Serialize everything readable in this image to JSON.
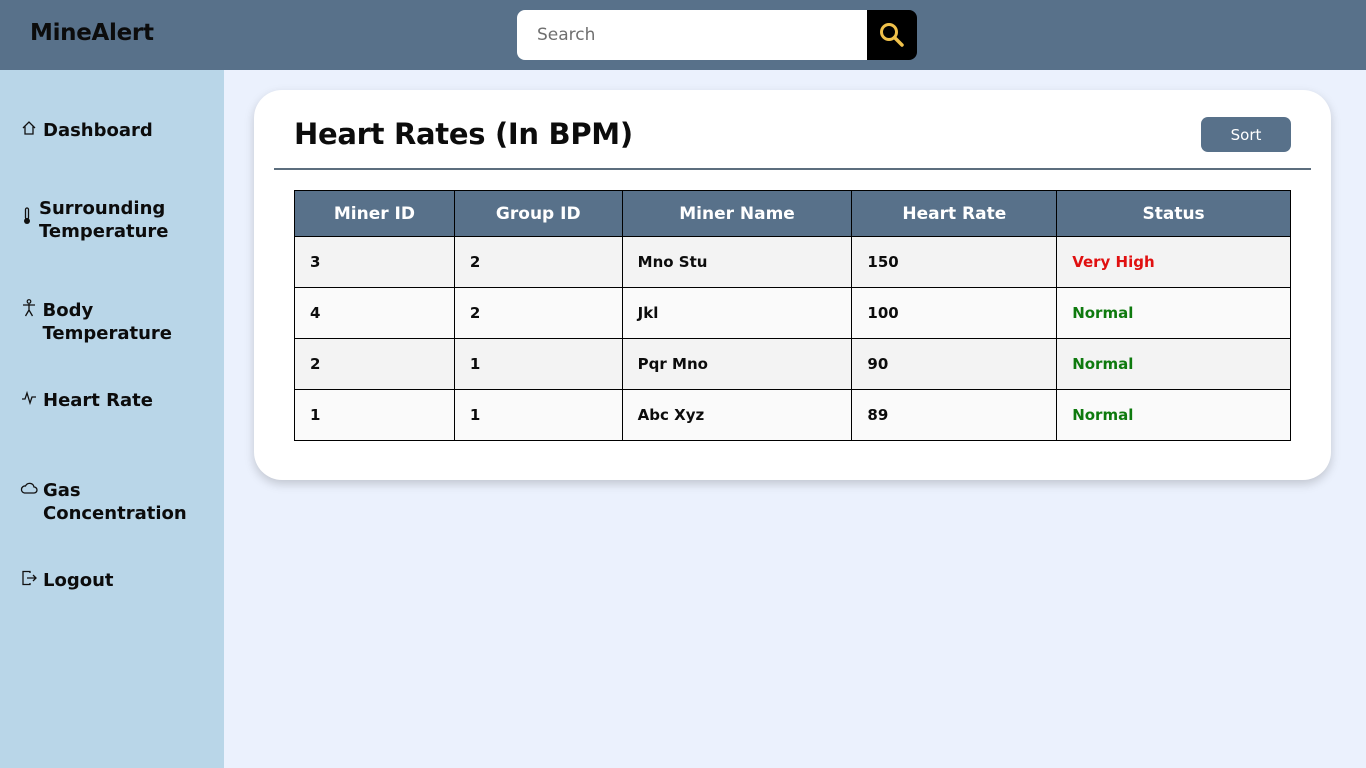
{
  "app": {
    "title": "MineAlert"
  },
  "search": {
    "placeholder": "Search",
    "icon": "search-icon",
    "icon_color": "#f0c14b"
  },
  "sidebar": {
    "items": [
      {
        "label": "Dashboard",
        "icon": "home-icon"
      },
      {
        "label": "Surrounding Temperature",
        "icon": "thermometer-icon"
      },
      {
        "label": "Body Temperature",
        "icon": "body-icon"
      },
      {
        "label": "Heart Rate",
        "icon": "pulse-icon"
      },
      {
        "label": "Gas Concentration",
        "icon": "cloud-icon"
      },
      {
        "label": "Logout",
        "icon": "logout-icon"
      }
    ]
  },
  "main": {
    "title": "Heart Rates (In BPM)",
    "sort_label": "Sort",
    "table": {
      "headers": [
        "Miner ID",
        "Group ID",
        "Miner Name",
        "Heart Rate",
        "Status"
      ],
      "rows": [
        [
          "3",
          "2",
          "Mno Stu",
          "150",
          "Very High"
        ],
        [
          "4",
          "2",
          "Jkl",
          "100",
          "Normal"
        ],
        [
          "2",
          "1",
          "Pqr Mno",
          "90",
          "Normal"
        ],
        [
          "1",
          "1",
          "Abc Xyz",
          "89",
          "Normal"
        ]
      ]
    }
  },
  "colors": {
    "header_bg": "#58718a",
    "sidebar_bg": "#b9d6e8",
    "page_bg": "#ebf1fd",
    "status_very_high": "#e01010",
    "status_normal": "#0e7a0e"
  }
}
